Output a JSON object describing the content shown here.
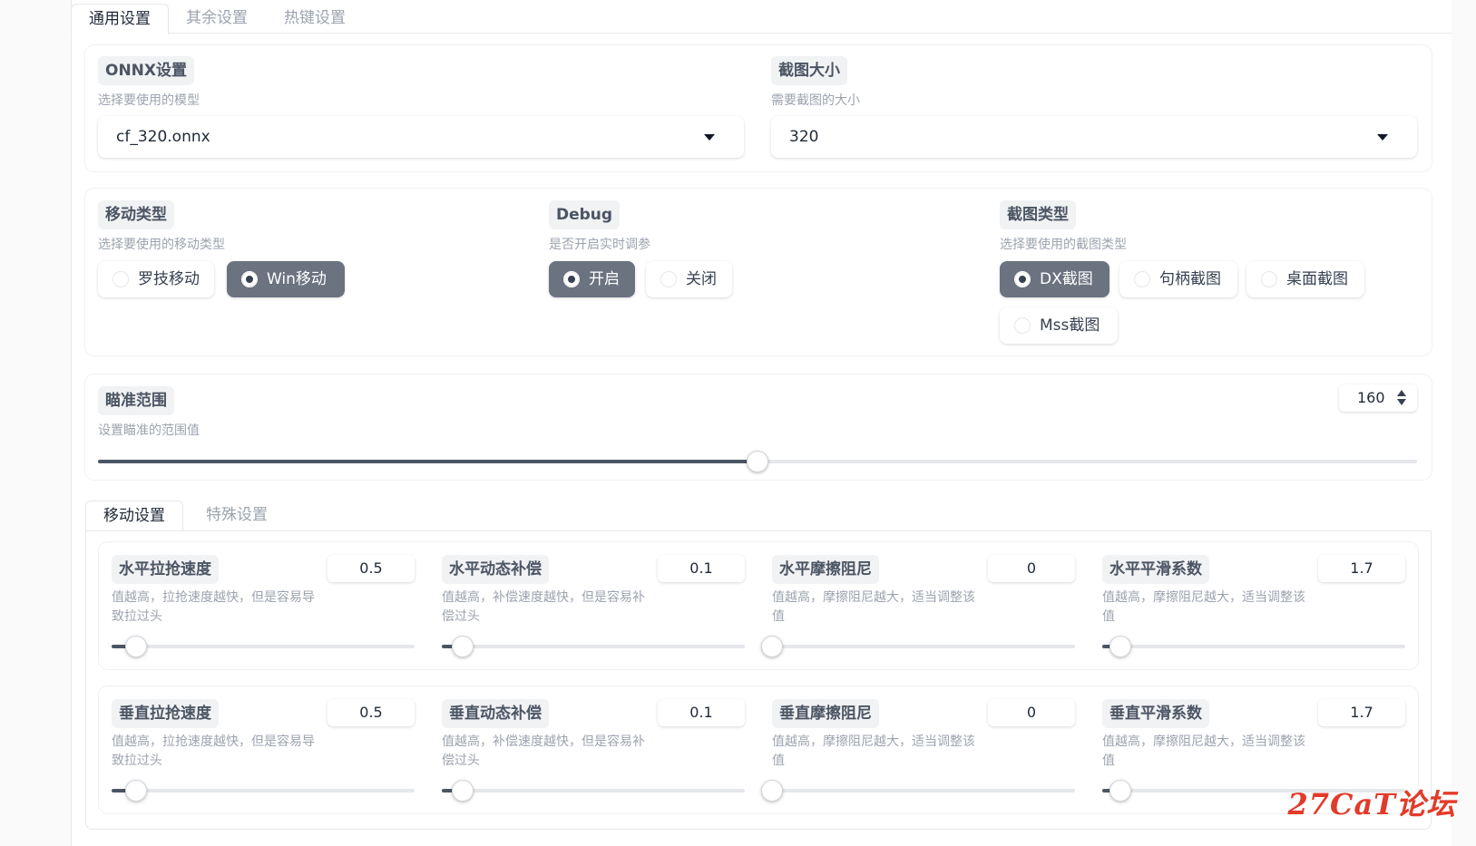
{
  "tabs": [
    {
      "label": "通用设置",
      "active": true
    },
    {
      "label": "其余设置",
      "active": false
    },
    {
      "label": "热键设置",
      "active": false
    }
  ],
  "onnx": {
    "title": "ONNX设置",
    "desc": "选择要使用的模型",
    "value": "cf_320.onnx"
  },
  "capture_size": {
    "title": "截图大小",
    "desc": "需要截图的大小",
    "value": "320"
  },
  "move_type": {
    "title": "移动类型",
    "desc": "选择要使用的移动类型",
    "options": [
      {
        "label": "罗技移动",
        "selected": false
      },
      {
        "label": "Win移动",
        "selected": true
      }
    ]
  },
  "debug": {
    "title": "Debug",
    "desc": "是否开启实时调参",
    "options": [
      {
        "label": "开启",
        "selected": true
      },
      {
        "label": "关闭",
        "selected": false
      }
    ]
  },
  "capture_type": {
    "title": "截图类型",
    "desc": "选择要使用的截图类型",
    "options": [
      {
        "label": "DX截图",
        "selected": true
      },
      {
        "label": "句柄截图",
        "selected": false
      },
      {
        "label": "桌面截图",
        "selected": false
      },
      {
        "label": "Mss截图",
        "selected": false
      }
    ]
  },
  "aim_range": {
    "title": "瞄准范围",
    "desc": "设置瞄准的范围值",
    "value": "160",
    "fraction": 0.5
  },
  "sub_tabs": [
    {
      "label": "移动设置",
      "active": true
    },
    {
      "label": "特殊设置",
      "active": false
    }
  ],
  "sliders_row1": [
    {
      "title": "水平拉抢速度",
      "desc": "值越高，拉抢速度越快，但是容易导致拉过头",
      "value": "0.5",
      "fraction": 0.08
    },
    {
      "title": "水平动态补偿",
      "desc": "值越高，补偿速度越快，但是容易补偿过头",
      "value": "0.1",
      "fraction": 0.07
    },
    {
      "title": "水平摩擦阻尼",
      "desc": "值越高，摩擦阻尼越大，适当调整该值",
      "value": "0",
      "fraction": 0.0
    },
    {
      "title": "水平平滑系数",
      "desc": "值越高，摩擦阻尼越大，适当调整该值",
      "value": "1.7",
      "fraction": 0.06
    }
  ],
  "sliders_row2": [
    {
      "title": "垂直拉抢速度",
      "desc": "值越高，拉抢速度越快，但是容易导致拉过头",
      "value": "0.5",
      "fraction": 0.08
    },
    {
      "title": "垂直动态补偿",
      "desc": "值越高，补偿速度越快，但是容易补偿过头",
      "value": "0.1",
      "fraction": 0.07
    },
    {
      "title": "垂直摩擦阻尼",
      "desc": "值越高，摩擦阻尼越大，适当调整该值",
      "value": "0",
      "fraction": 0.0
    },
    {
      "title": "垂直平滑系数",
      "desc": "值越高，摩擦阻尼越大，适当调整该值",
      "value": "1.7",
      "fraction": 0.06
    }
  ],
  "watermark": "27CaT论坛"
}
